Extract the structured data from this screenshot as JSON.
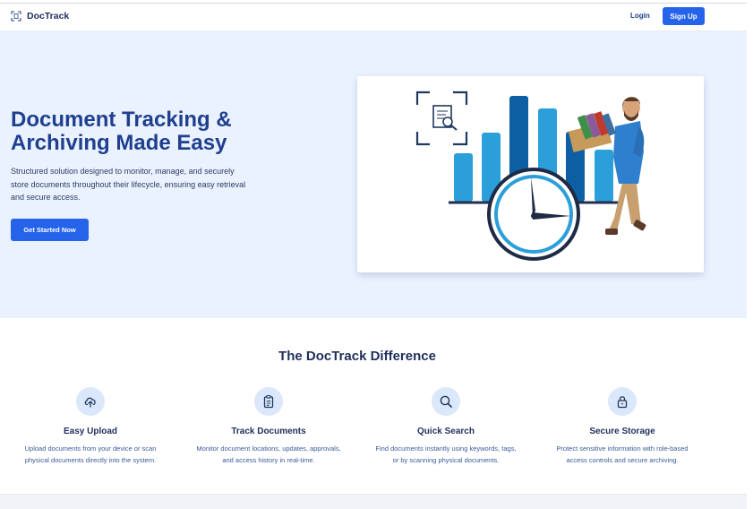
{
  "nav": {
    "brand": "DocTrack",
    "brand_icon": "scan-document-icon",
    "login_label": "Login",
    "signup_label": "Sign Up"
  },
  "hero": {
    "title_line1": "Document Tracking &",
    "title_line2": "Archiving Made Easy",
    "description": "Structured solution designed to monitor, manage, and securely store documents throughout their lifecycle, ensuring easy retrieval and secure access.",
    "cta_label": "Get Started Now",
    "illustration": "person-carrying-folders-with-bar-chart-and-clock"
  },
  "features": {
    "title": "The DocTrack Difference",
    "items": [
      {
        "icon": "cloud-upload-icon",
        "title": "Easy Upload",
        "desc_line1": "Upload documents from your device or scan",
        "desc_line2": "physical documents directly into the system."
      },
      {
        "icon": "clipboard-icon",
        "title": "Track Documents",
        "desc_line1": "Monitor document locations, updates, approvals,",
        "desc_line2": "and access history in real-time."
      },
      {
        "icon": "search-icon",
        "title": "Quick Search",
        "desc_line1": "Find documents instantly using keywords, tags,",
        "desc_line2": "or by scanning physical documents."
      },
      {
        "icon": "lock-icon",
        "title": "Secure Storage",
        "desc_line1": "Protect sensitive information with role-based",
        "desc_line2": "access controls and secure archiving."
      }
    ]
  },
  "colors": {
    "primary": "#2563eb",
    "heading": "#1f3f8f",
    "hero_bg": "#eaf2ff",
    "icon_circle": "#dbe7fb"
  }
}
